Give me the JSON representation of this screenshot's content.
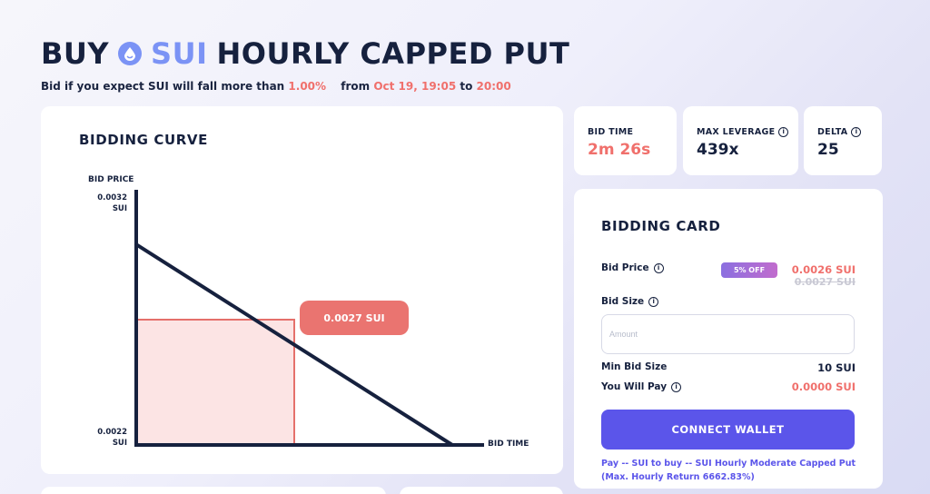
{
  "header": {
    "buy": "BUY",
    "asset": "SUI",
    "product": "HOURLY CAPPED PUT",
    "sub_prefix": "Bid if you expect SUI will fall more than",
    "threshold": "1.00%",
    "from_label": "from",
    "start": "Oct 19, 19:05",
    "to_label": "to",
    "end": "20:00"
  },
  "chart": {
    "title": "BIDDING CURVE",
    "chart_data": {
      "type": "line",
      "title": "BIDDING CURVE",
      "ylabel": "BID PRICE",
      "xlabel": "BID TIME",
      "y_ticks": [
        "0.0032\nSUI",
        "0.0022\nSUI"
      ],
      "y_tick_top": "0.0032",
      "y_tick_top_unit": "SUI",
      "y_tick_bottom": "0.0022",
      "y_tick_bottom_unit": "SUI",
      "ylim": [
        0.0022,
        0.0032
      ],
      "x": [
        0,
        1
      ],
      "y": [
        0.003,
        0.0022
      ],
      "current": {
        "x": 0.5,
        "y": 0.0027
      },
      "current_label": "0.0027 SUI"
    }
  },
  "stats": {
    "bid_time_label": "BID TIME",
    "bid_time_value": "2m 26s",
    "leverage_label": "MAX LEVERAGE",
    "leverage_value": "439x",
    "delta_label": "DELTA",
    "delta_value": "25"
  },
  "bidding_card": {
    "title": "BIDDING CARD",
    "bid_price_label": "Bid Price",
    "discount": "5% OFF",
    "price_new": "0.0026 SUI",
    "price_old": "0.0027 SUI",
    "bid_size_label": "Bid Size",
    "amount_placeholder": "Amount",
    "amount_value": "",
    "min_bid_label": "Min Bid Size",
    "min_bid_value": "10 SUI",
    "you_pay_label": "You Will Pay",
    "you_pay_value": "0.0000 SUI",
    "connect_label": "CONNECT WALLET",
    "note": "Pay -- SUI to buy -- SUI Hourly Moderate Capped Put (Max. Hourly Return 6662.83%)"
  },
  "colors": {
    "accent": "#7b93f5",
    "red": "#f0706c",
    "button": "#5b55ea",
    "dark": "#16213e"
  }
}
